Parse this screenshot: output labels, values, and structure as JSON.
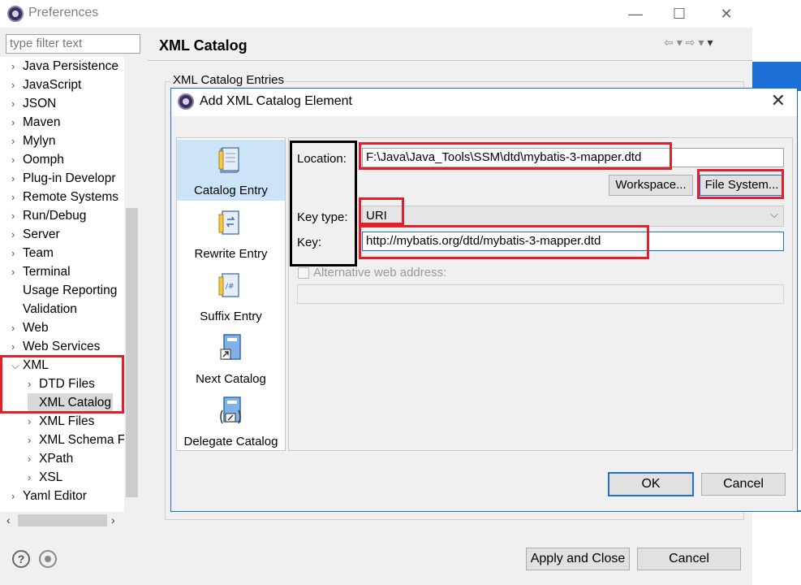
{
  "window": {
    "title": "Preferences"
  },
  "filter": {
    "placeholder": "type filter text"
  },
  "tree": {
    "items": [
      {
        "label": "Java Persistence",
        "chevron": true,
        "indent": 0
      },
      {
        "label": "JavaScript",
        "chevron": true,
        "indent": 0
      },
      {
        "label": "JSON",
        "chevron": true,
        "indent": 0
      },
      {
        "label": "Maven",
        "chevron": true,
        "indent": 0
      },
      {
        "label": "Mylyn",
        "chevron": true,
        "indent": 0
      },
      {
        "label": "Oomph",
        "chevron": true,
        "indent": 0
      },
      {
        "label": "Plug-in Developr",
        "chevron": true,
        "indent": 0
      },
      {
        "label": "Remote Systems",
        "chevron": true,
        "indent": 0
      },
      {
        "label": "Run/Debug",
        "chevron": true,
        "indent": 0
      },
      {
        "label": "Server",
        "chevron": true,
        "indent": 0
      },
      {
        "label": "Team",
        "chevron": true,
        "indent": 0
      },
      {
        "label": "Terminal",
        "chevron": true,
        "indent": 0
      },
      {
        "label": "Usage Reporting",
        "chevron": false,
        "indent": 0
      },
      {
        "label": "Validation",
        "chevron": false,
        "indent": 0
      },
      {
        "label": "Web",
        "chevron": true,
        "indent": 0
      },
      {
        "label": "Web Services",
        "chevron": true,
        "indent": 0
      },
      {
        "label": "XML",
        "chevron": "open",
        "indent": 0
      },
      {
        "label": "DTD Files",
        "chevron": true,
        "indent": 1
      },
      {
        "label": "XML Catalog",
        "chevron": false,
        "indent": 1,
        "selected": true
      },
      {
        "label": "XML Files",
        "chevron": true,
        "indent": 1
      },
      {
        "label": "XML Schema F",
        "chevron": true,
        "indent": 1
      },
      {
        "label": "XPath",
        "chevron": true,
        "indent": 1
      },
      {
        "label": "XSL",
        "chevron": true,
        "indent": 1
      },
      {
        "label": "Yaml Editor",
        "chevron": true,
        "indent": 0
      }
    ]
  },
  "page": {
    "title": "XML Catalog",
    "group_label": "XML Catalog Entries"
  },
  "buttons": {
    "apply_close": "Apply and Close",
    "cancel": "Cancel"
  },
  "dialog": {
    "title": "Add XML Catalog Element",
    "types": [
      {
        "label": "Catalog Entry",
        "selected": true
      },
      {
        "label": "Rewrite Entry",
        "selected": false
      },
      {
        "label": "Suffix Entry",
        "selected": false
      },
      {
        "label": "Next Catalog",
        "selected": false
      },
      {
        "label": "Delegate Catalog",
        "selected": false
      }
    ],
    "location_label": "Location:",
    "location_value": "F:\\Java\\Java_Tools\\SSM\\dtd\\mybatis-3-mapper.dtd",
    "workspace_button": "Workspace...",
    "filesystem_button": "File System...",
    "keytype_label": "Key type:",
    "keytype_value": "URI",
    "key_label": "Key:",
    "key_value": "http://mybatis.org/dtd/mybatis-3-mapper.dtd",
    "alt_web_label": "Alternative web address:",
    "ok_button": "OK",
    "cancel_button": "Cancel"
  },
  "colors": {
    "highlight_red": "#e0202c",
    "selection_blue": "#cce4f7",
    "accent_blue": "#1c6fd6"
  }
}
